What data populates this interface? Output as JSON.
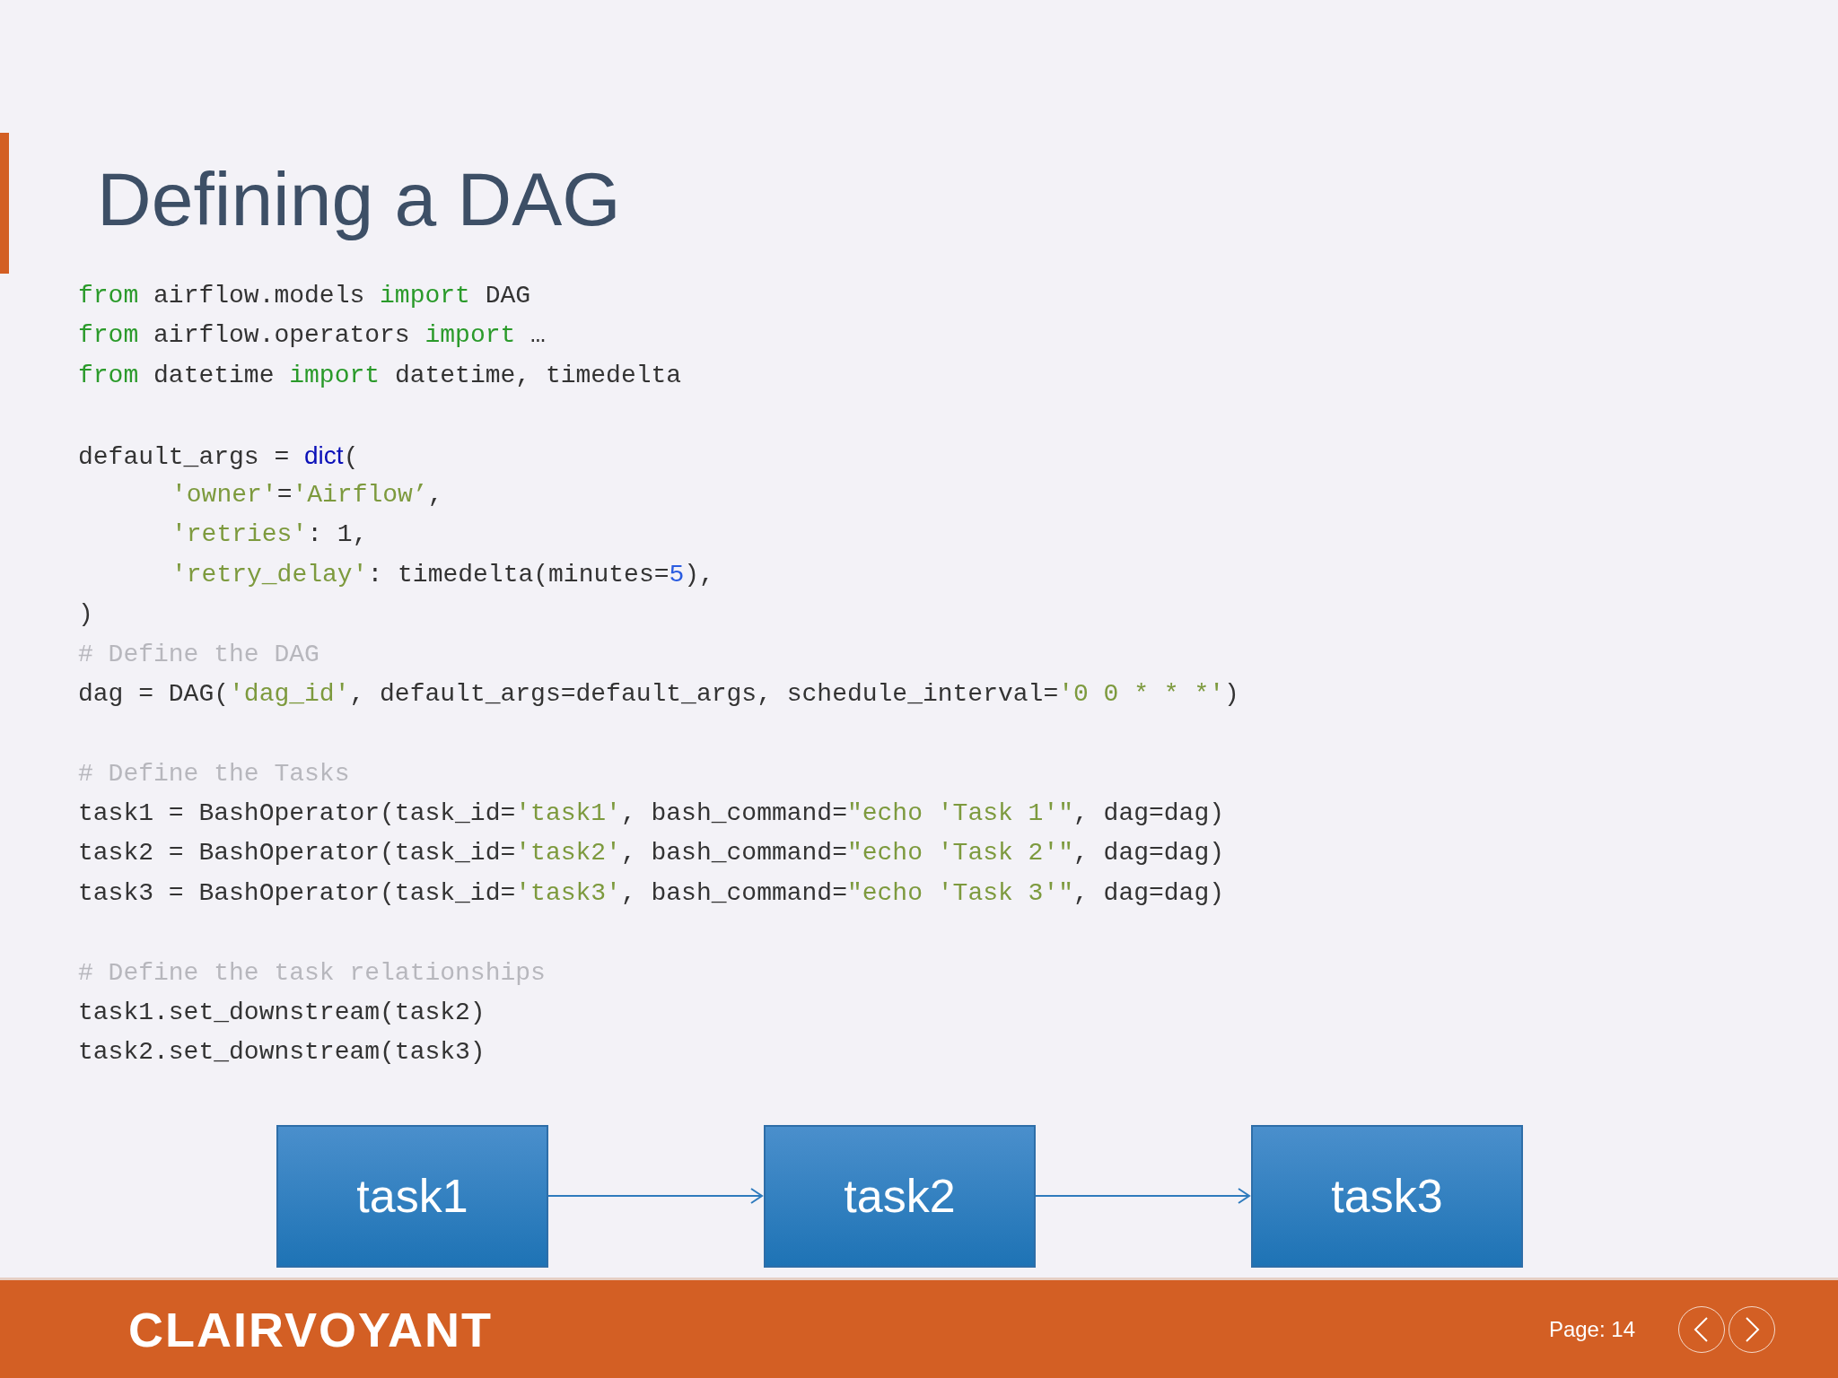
{
  "slide": {
    "title": "Defining a DAG",
    "code_lines": [
      {
        "kind": "code",
        "tokens": [
          {
            "kind": "keyword",
            "text": "from"
          },
          {
            "kind": "plain",
            "text": " airflow.models "
          },
          {
            "kind": "keyword",
            "text": "import"
          },
          {
            "kind": "plain",
            "text": " DAG"
          }
        ]
      },
      {
        "kind": "code",
        "tokens": [
          {
            "kind": "keyword",
            "text": "from"
          },
          {
            "kind": "plain",
            "text": " airflow.operators "
          },
          {
            "kind": "keyword",
            "text": "import"
          },
          {
            "kind": "plain",
            "text": " …"
          }
        ]
      },
      {
        "kind": "code",
        "tokens": [
          {
            "kind": "keyword",
            "text": "from"
          },
          {
            "kind": "plain",
            "text": " datetime "
          },
          {
            "kind": "keyword",
            "text": "import"
          },
          {
            "kind": "plain",
            "text": " datetime, timedelta"
          }
        ]
      },
      {
        "kind": "blank"
      },
      {
        "kind": "code",
        "tokens": [
          {
            "kind": "plain",
            "text": "default_args = "
          },
          {
            "kind": "builtin",
            "text": "dict"
          },
          {
            "kind": "plain",
            "text": "("
          }
        ]
      },
      {
        "kind": "indented",
        "tokens": [
          {
            "kind": "string",
            "text": "'owner'"
          },
          {
            "kind": "plain",
            "text": "="
          },
          {
            "kind": "string",
            "text": "'Airflow’"
          },
          {
            "kind": "plain",
            "text": ","
          }
        ]
      },
      {
        "kind": "indented",
        "tokens": [
          {
            "kind": "string",
            "text": "'retries'"
          },
          {
            "kind": "plain",
            "text": ": 1,"
          }
        ]
      },
      {
        "kind": "indented",
        "tokens": [
          {
            "kind": "string",
            "text": "'retry_delay'"
          },
          {
            "kind": "plain",
            "text": ": timedelta(minutes="
          },
          {
            "kind": "number",
            "text": "5"
          },
          {
            "kind": "plain",
            "text": "),"
          }
        ]
      },
      {
        "kind": "code",
        "tokens": [
          {
            "kind": "plain",
            "text": ")"
          }
        ]
      },
      {
        "kind": "code",
        "tokens": [
          {
            "kind": "comment",
            "text": "# Define the DAG"
          }
        ]
      },
      {
        "kind": "code",
        "tokens": [
          {
            "kind": "plain",
            "text": "dag = DAG("
          },
          {
            "kind": "string",
            "text": "'dag_id'"
          },
          {
            "kind": "plain",
            "text": ", default_args=default_args, schedule_interval="
          },
          {
            "kind": "string",
            "text": "'0 0 * * *'"
          },
          {
            "kind": "plain",
            "text": ")"
          }
        ]
      },
      {
        "kind": "blank"
      },
      {
        "kind": "code",
        "tokens": [
          {
            "kind": "comment",
            "text": "# Define the Tasks"
          }
        ]
      },
      {
        "kind": "code",
        "tokens": [
          {
            "kind": "plain",
            "text": "task1 = BashOperator(task_id="
          },
          {
            "kind": "string",
            "text": "'task1'"
          },
          {
            "kind": "plain",
            "text": ", bash_command="
          },
          {
            "kind": "string",
            "text": "\"echo 'Task 1'\""
          },
          {
            "kind": "plain",
            "text": ", dag=dag)"
          }
        ]
      },
      {
        "kind": "code",
        "tokens": [
          {
            "kind": "plain",
            "text": "task2 = BashOperator(task_id="
          },
          {
            "kind": "string",
            "text": "'task2'"
          },
          {
            "kind": "plain",
            "text": ", bash_command="
          },
          {
            "kind": "string",
            "text": "\"echo 'Task 2'\""
          },
          {
            "kind": "plain",
            "text": ", dag=dag)"
          }
        ]
      },
      {
        "kind": "code",
        "tokens": [
          {
            "kind": "plain",
            "text": "task3 = BashOperator(task_id="
          },
          {
            "kind": "string",
            "text": "'task3'"
          },
          {
            "kind": "plain",
            "text": ", bash_command="
          },
          {
            "kind": "string",
            "text": "\"echo 'Task 3'\""
          },
          {
            "kind": "plain",
            "text": ", dag=dag)"
          }
        ]
      },
      {
        "kind": "blank"
      },
      {
        "kind": "code",
        "tokens": [
          {
            "kind": "comment",
            "text": "# Define the task relationships"
          }
        ]
      },
      {
        "kind": "code",
        "tokens": [
          {
            "kind": "plain",
            "text": "task1.set_downstream(task2)"
          }
        ]
      },
      {
        "kind": "code",
        "tokens": [
          {
            "kind": "plain",
            "text": "task2.set_downstream(task3)"
          }
        ]
      }
    ],
    "diagram": {
      "nodes": [
        {
          "label": "task1"
        },
        {
          "label": "task2"
        },
        {
          "label": "task3"
        }
      ]
    }
  },
  "footer": {
    "logo": "CLAIRVOYANT",
    "page": "Page: 14"
  }
}
